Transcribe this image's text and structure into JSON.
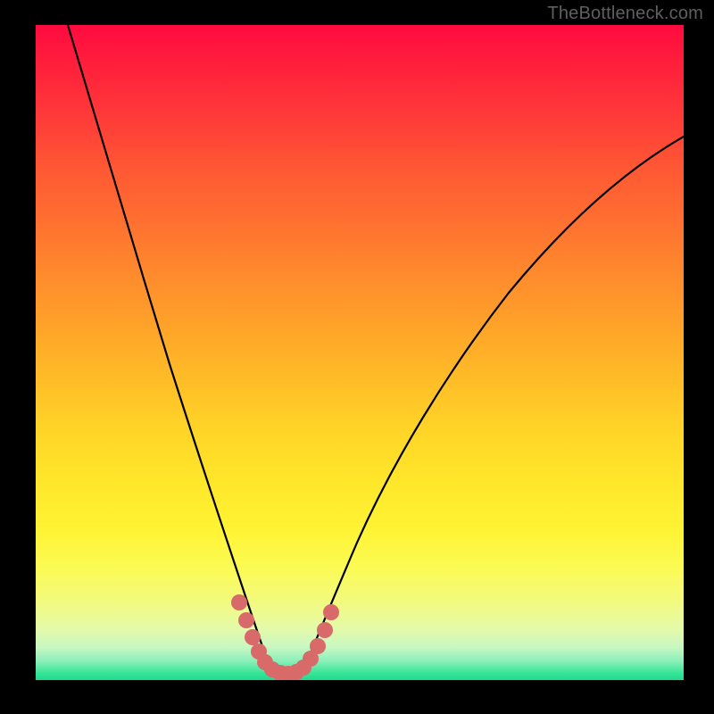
{
  "watermark": "TheBottleneck.com",
  "colors": {
    "curve_stroke": "#000000",
    "marker_fill": "#d86a6a",
    "marker_stroke": "#c85858",
    "background_black": "#000000"
  },
  "chart_data": {
    "type": "line",
    "title": "",
    "xlabel": "",
    "ylabel": "",
    "xlim": [
      0,
      100
    ],
    "ylim": [
      0,
      100
    ],
    "grid": false,
    "legend": false,
    "note": "No numeric tick labels or axis text are rendered in the image; values below are pixel-proportional estimates (0–100) read from curve geometry, where y=0 is the bottom green band and y=100 is the top.",
    "series": [
      {
        "name": "left-branch",
        "x": [
          5,
          8,
          11,
          14,
          17,
          20,
          23,
          26,
          28,
          30,
          31.5,
          33,
          34,
          35
        ],
        "y": [
          100,
          91,
          82,
          72,
          62,
          52,
          42,
          32,
          24,
          16,
          10,
          5,
          2.5,
          1
        ]
      },
      {
        "name": "right-branch",
        "x": [
          40,
          41.5,
          43.5,
          46,
          49,
          53,
          58,
          64,
          71,
          79,
          88,
          100
        ],
        "y": [
          1,
          3,
          8,
          14,
          21,
          30,
          40,
          50,
          59,
          67,
          74,
          82
        ]
      },
      {
        "name": "valley-markers",
        "x": [
          30.5,
          31.8,
          33,
          34,
          35,
          36.2,
          37.5,
          38.8,
          40,
          41,
          42,
          43.3
        ],
        "y": [
          13,
          8.5,
          5,
          2.8,
          1.5,
          1,
          1,
          1.3,
          2,
          3.2,
          5.5,
          9
        ]
      }
    ]
  }
}
